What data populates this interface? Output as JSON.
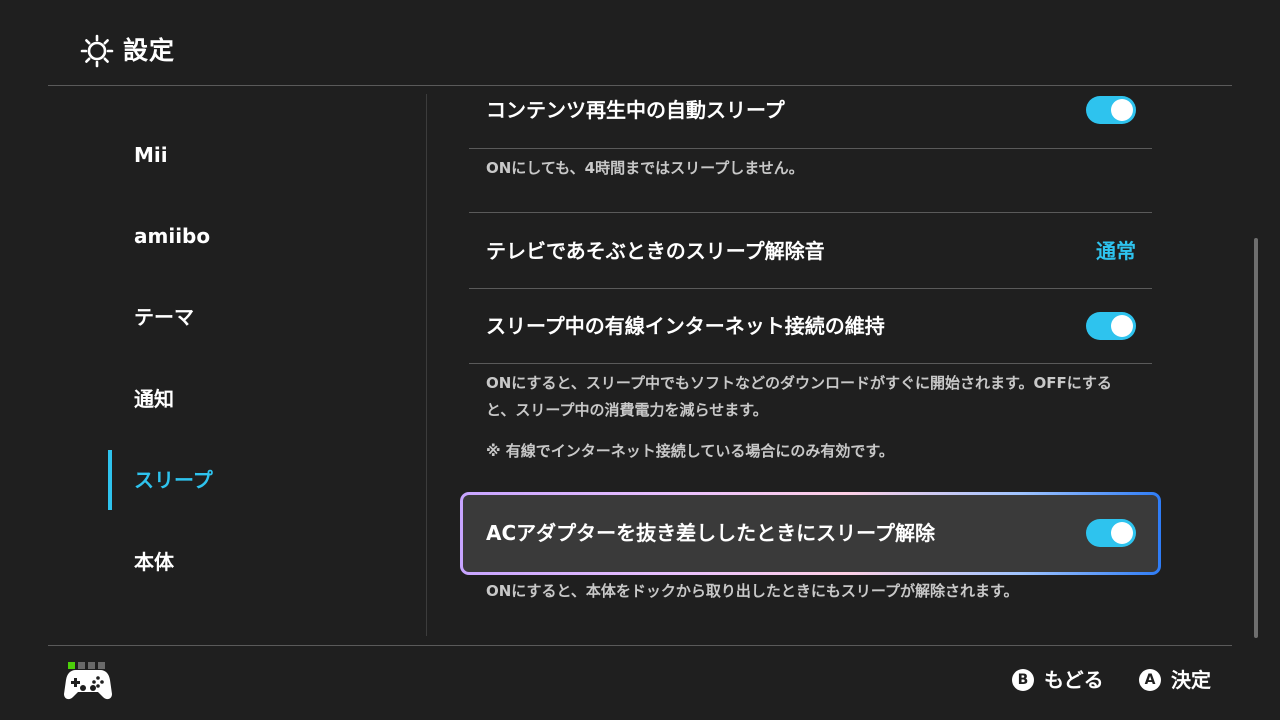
{
  "header": {
    "title": "設定",
    "icon": "gear-icon"
  },
  "sidebar": {
    "items": [
      {
        "label": "Mii"
      },
      {
        "label": "amiibo"
      },
      {
        "label": "テーマ"
      },
      {
        "label": "通知"
      },
      {
        "label": "スリープ",
        "active": true
      },
      {
        "label": "本体"
      }
    ]
  },
  "main": {
    "rows": [
      {
        "title": "コンテンツ再生中の自動スリープ",
        "toggle": "on",
        "description": "ONにしても、4時間まではスリープしません。"
      },
      {
        "title": "テレビであそぶときのスリープ解除音",
        "value": "通常"
      },
      {
        "title": "スリープ中の有線インターネット接続の維持",
        "toggle": "on",
        "description": "ONにすると、スリープ中でもソフトなどのダウンロードがすぐに開始されます。OFFにすると、スリープ中の消費電力を減らせます。",
        "note": "※ 有線でインターネット接続している場合にのみ有効です。"
      },
      {
        "title": "ACアダプターを抜き差ししたときにスリープ解除",
        "toggle": "on",
        "focused": true,
        "description": "ONにすると、本体をドックから取り出したときにもスリープが解除されます。"
      }
    ]
  },
  "footer": {
    "back": {
      "glyph": "B",
      "label": "もどる"
    },
    "confirm": {
      "glyph": "A",
      "label": "決定"
    },
    "controller_icon": "gamepad-icon"
  },
  "colors": {
    "accent": "#2ec3ee",
    "background": "#1f1f1f",
    "player_indicator": "#4cd00a"
  }
}
